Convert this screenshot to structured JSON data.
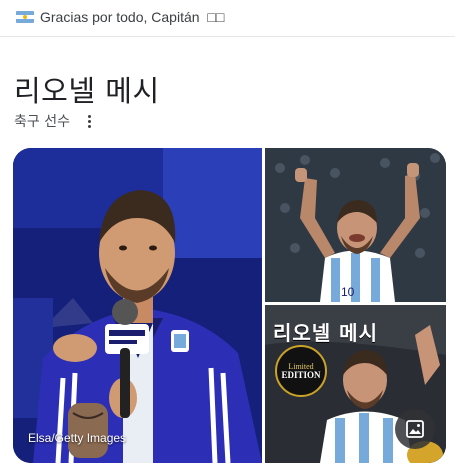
{
  "banner": {
    "text": "Gracias por todo, Capitán",
    "flag_icon": "argentina-flag-icon",
    "trailing_glyphs": "□□"
  },
  "entity": {
    "title": "리오넬 메시",
    "subtitle": "축구 선수",
    "more_icon": "more-vert-icon"
  },
  "gallery": {
    "main_image": {
      "credit": "Elsa/Getty Images",
      "depicts": "Lionel Messi seated, Argentina jacket, holding microphone"
    },
    "thumb_top": {
      "depicts": "Messi in Argentina jersey celebrating with both arms raised"
    },
    "thumb_bottom": {
      "poster_title": "리오넬 메시",
      "badge_line1": "Limited",
      "badge_line2": "EDITION",
      "depicts": "Messi book cover, holding trophy"
    },
    "image_search_icon": "image-search-icon"
  },
  "colors": {
    "title": "#202124",
    "subtitle": "#4d5156",
    "argentina_blue": "#75aadb"
  }
}
